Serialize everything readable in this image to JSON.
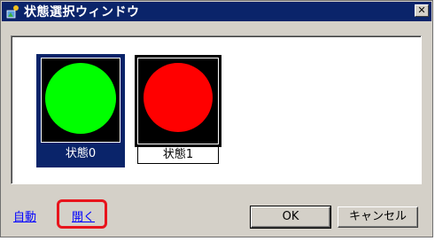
{
  "window": {
    "title": "状態選択ウィンドウ",
    "close_glyph": "✕"
  },
  "states": [
    {
      "label": "状態0",
      "color": "#00ff00",
      "selected": true
    },
    {
      "label": "状態1",
      "color": "#ff0000",
      "selected": false
    }
  ],
  "links": {
    "auto": "自動",
    "open": "開く"
  },
  "buttons": {
    "ok": "OK",
    "cancel": "キャンセル"
  },
  "colors": {
    "titlebar": "#0a246a",
    "highlight": "#e8141c"
  }
}
